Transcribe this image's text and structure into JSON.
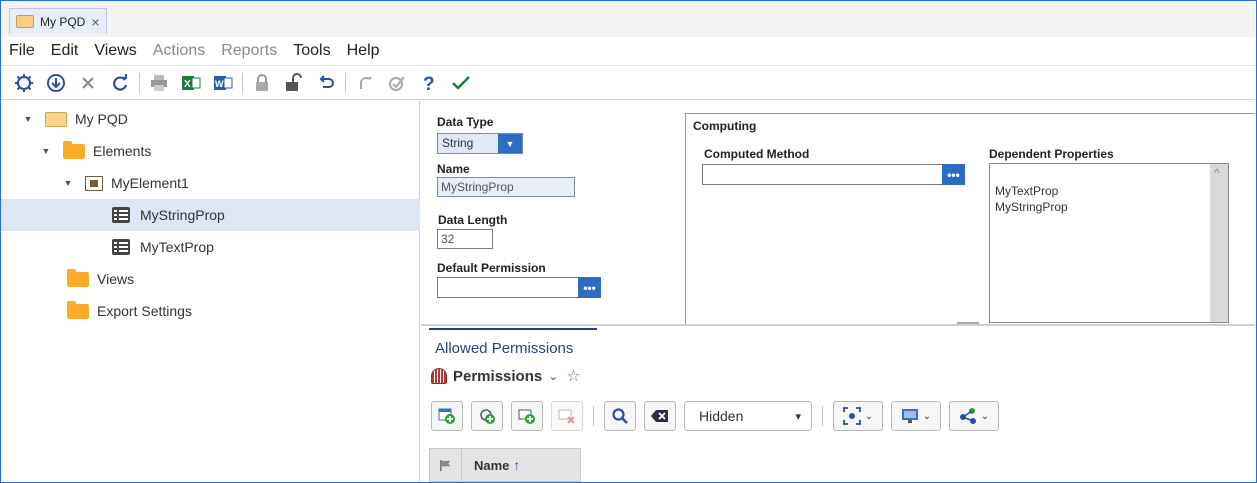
{
  "tab": {
    "title": "My PQD",
    "close": "×"
  },
  "menu": [
    {
      "label": "File",
      "disabled": false
    },
    {
      "label": "Edit",
      "disabled": false
    },
    {
      "label": "Views",
      "disabled": false
    },
    {
      "label": "Actions",
      "disabled": true
    },
    {
      "label": "Reports",
      "disabled": true
    },
    {
      "label": "Tools",
      "disabled": false
    },
    {
      "label": "Help",
      "disabled": false
    }
  ],
  "toolbar_icons": [
    "settings-icon",
    "download-icon",
    "cancel-icon",
    "refresh-icon",
    "print-icon",
    "excel-icon",
    "word-icon",
    "lock-icon",
    "unlock-icon",
    "undo-icon",
    "redo-icon",
    "validate-icon",
    "help-icon",
    "check-icon"
  ],
  "tree": {
    "root": "My PQD",
    "elements": "Elements",
    "element1": "MyElement1",
    "prop1": "MyStringProp",
    "prop2": "MyTextProp",
    "views": "Views",
    "export": "Export Settings"
  },
  "props": {
    "data_type_label": "Data Type",
    "data_type_value": "String",
    "name_label": "Name",
    "name_value": "MyStringProp",
    "data_length_label": "Data Length",
    "data_length_value": "32",
    "default_perm_label": "Default Permission",
    "default_perm_value": "",
    "ellipsis": "•••",
    "computing_label": "Computing",
    "computed_method_label": "Computed Method",
    "computed_method_value": "",
    "dependent_label": "Dependent Properties",
    "dependent_items": [
      "MyTextProp",
      "MyStringProp"
    ]
  },
  "permissions": {
    "tab_label": "Allowed Permissions",
    "title": "Permissions",
    "filter_value": "Hidden",
    "col_name": "Name",
    "sort_arrow": "🠕"
  },
  "colors": {
    "accent": "#2d6cc0",
    "folder": "#f9ad2b",
    "selected_row": "#dde6f5"
  }
}
